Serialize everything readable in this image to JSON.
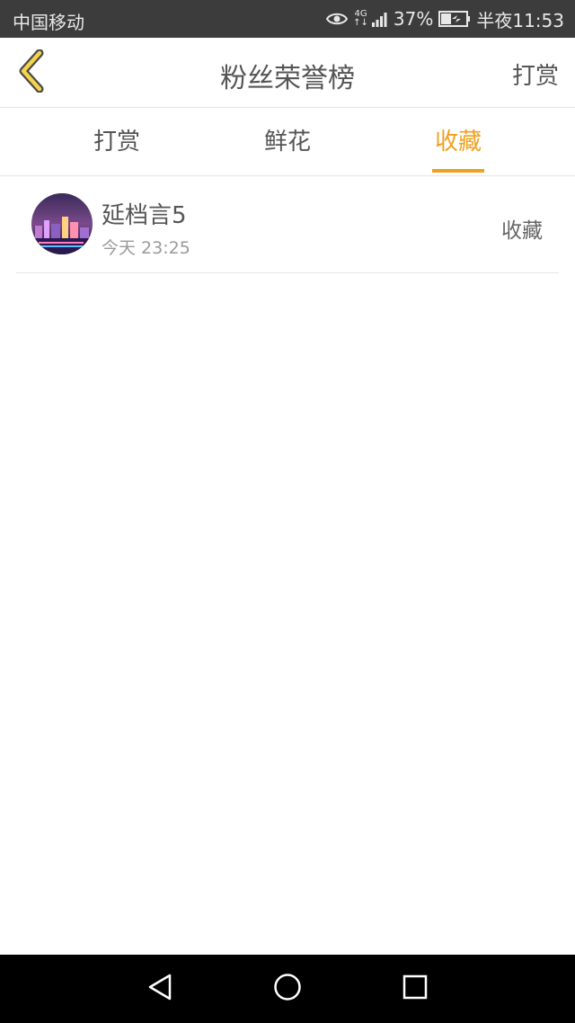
{
  "status_bar": {
    "carrier": "中国移动",
    "network_top": "4G",
    "network_bottom": "↑↓",
    "battery_percent": "37%",
    "time": "半夜11:53"
  },
  "header": {
    "title": "粉丝荣誉榜",
    "action_label": "打赏"
  },
  "tabs": [
    {
      "label": "打赏",
      "active": false
    },
    {
      "label": "鲜花",
      "active": false
    },
    {
      "label": "收藏",
      "active": true
    }
  ],
  "list": [
    {
      "name": "延档言5",
      "time": "今天 23:25",
      "type": "收藏"
    }
  ],
  "colors": {
    "accent": "#f0a020",
    "text": "#555555",
    "status_bar_bg": "#3c3c3c",
    "nav_bar_bg": "#000000"
  }
}
